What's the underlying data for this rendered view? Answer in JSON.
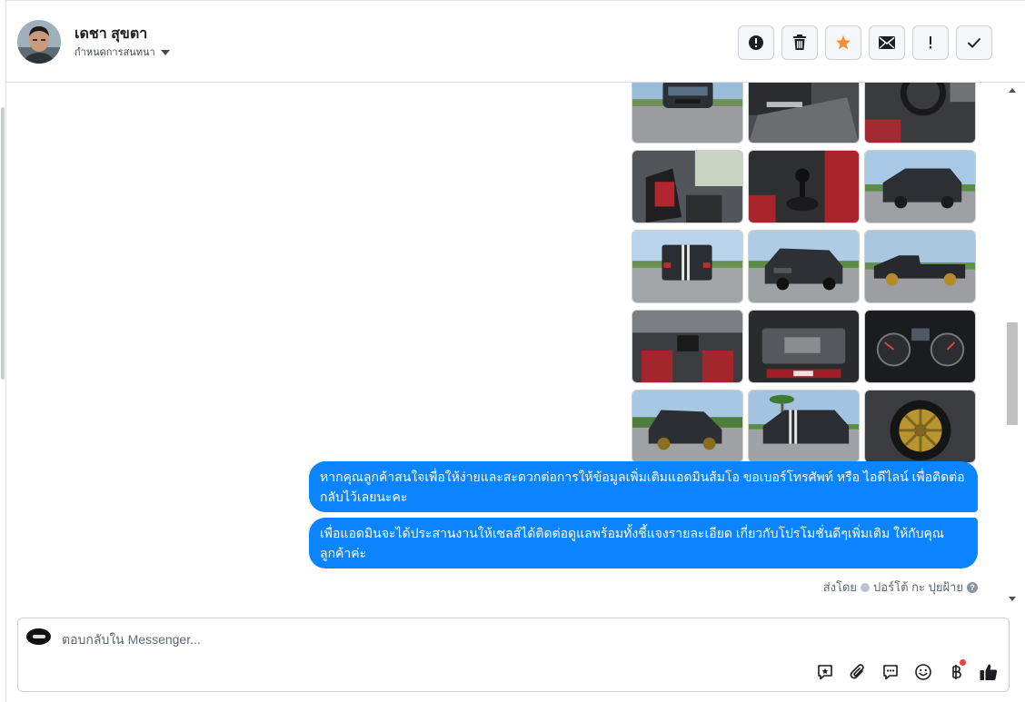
{
  "header": {
    "contact_name": "เดชา สุขตา",
    "assign_label": "กำหนดการสนทนา",
    "actions": [
      {
        "name": "spam-button",
        "icon": "exclamation-circle-icon"
      },
      {
        "name": "delete-button",
        "icon": "trash-icon"
      },
      {
        "name": "star-button",
        "icon": "star-icon",
        "active_color": "#f7923a"
      },
      {
        "name": "mark-unread-button",
        "icon": "envelope-icon"
      },
      {
        "name": "follow-up-button",
        "icon": "exclamation-icon"
      },
      {
        "name": "done-button",
        "icon": "check-icon"
      }
    ]
  },
  "thread": {
    "photos": [
      "truck-front",
      "door-interior",
      "steering-wheel",
      "seat-interior",
      "gear-shift",
      "truck-rear-side",
      "truck-rear",
      "truck-front-angle",
      "truck-side",
      "dashboard-interior",
      "engine-bay",
      "gauge-cluster",
      "truck-front-trees",
      "truck-rear-palm",
      "gold-wheel"
    ],
    "messages": [
      {
        "text": "หากคุณลูกค้าสนใจเพื่อให้ง่ายและสะดวกต่อการให้ข้อมูลเพิ่มเติมแอดมินส้มโอ ขอเบอร์โทรศัพท์ หรือ ไอดีไลน์ เพื่อติดต่อกลับไว้เลยนะคะ"
      },
      {
        "text": "เพื่อแอดมินจะได้ประสานงานให้เซลส์ได้ติดต่อดูแลพร้อมทั้งชี้แจงรายละเอียด เกี่ยวกับโปรโมชั่นดีๆเพิ่มเติม ให้กับคุณลูกค้าค่ะ"
      }
    ],
    "sent_by_label": "ส่งโดย",
    "sent_by_name": "ปอร์โต้ กะ ปุยฝ้าย",
    "bubble_color": "#0b84ff"
  },
  "composer": {
    "placeholder": "ตอบกลับใน Messenger...",
    "tools": [
      "saved-reply-icon",
      "attachment-icon",
      "chat-icon",
      "emoji-icon",
      "baht-payment-icon",
      "like-icon"
    ]
  }
}
